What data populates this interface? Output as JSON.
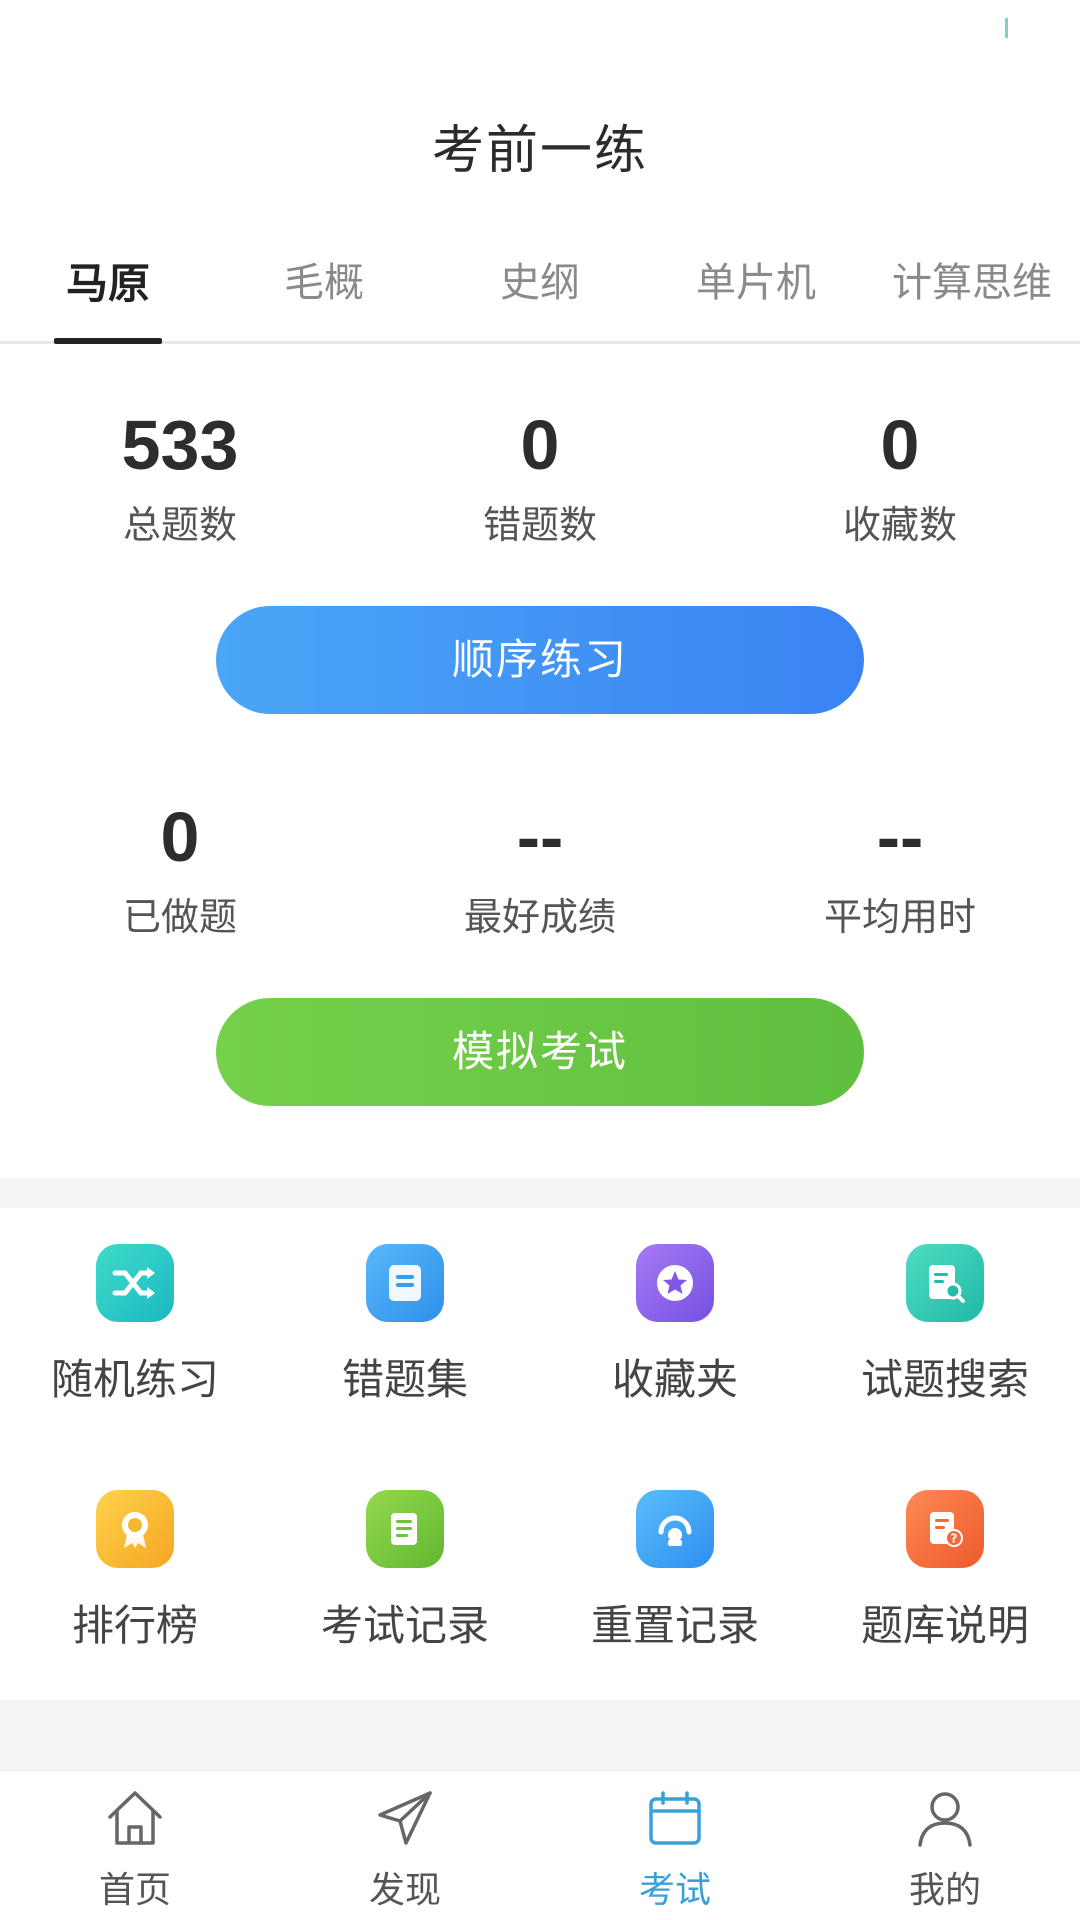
{
  "header": {
    "title": "考前一练"
  },
  "tabs": [
    {
      "label": "马原",
      "active": true
    },
    {
      "label": "毛概",
      "active": false
    },
    {
      "label": "史纲",
      "active": false
    },
    {
      "label": "单片机",
      "active": false
    },
    {
      "label": "计算思维",
      "active": false
    }
  ],
  "stats_top": [
    {
      "value": "533",
      "label": "总题数"
    },
    {
      "value": "0",
      "label": "错题数"
    },
    {
      "value": "0",
      "label": "收藏数"
    }
  ],
  "practice_button": {
    "label": "顺序练习"
  },
  "stats_bottom": [
    {
      "value": "0",
      "label": "已做题"
    },
    {
      "value": "--",
      "label": "最好成绩"
    },
    {
      "value": "--",
      "label": "平均用时"
    }
  ],
  "exam_button": {
    "label": "模拟考试"
  },
  "grid": [
    {
      "label": "随机练习",
      "icon": "shuffle-icon",
      "color": "#29c9c0"
    },
    {
      "label": "错题集",
      "icon": "document-icon",
      "color": "#3aa0f0"
    },
    {
      "label": "收藏夹",
      "icon": "star-icon",
      "color": "#8b64ea"
    },
    {
      "label": "试题搜索",
      "icon": "search-document-icon",
      "color": "#2cc7b0"
    },
    {
      "label": "排行榜",
      "icon": "award-icon",
      "color": "#f8b52c"
    },
    {
      "label": "考试记录",
      "icon": "scroll-icon",
      "color": "#79c53a"
    },
    {
      "label": "重置记录",
      "icon": "reset-icon",
      "color": "#3a9ef2"
    },
    {
      "label": "题库说明",
      "icon": "help-document-icon",
      "color": "#f66a3c"
    }
  ],
  "nav": [
    {
      "label": "首页",
      "icon": "home-icon",
      "active": false
    },
    {
      "label": "发现",
      "icon": "send-icon",
      "active": false
    },
    {
      "label": "考试",
      "icon": "calendar-icon",
      "active": true
    },
    {
      "label": "我的",
      "icon": "user-icon",
      "active": false
    }
  ],
  "colors": {
    "accent": "#3aa0d8",
    "blue_button": "#3a83f3",
    "green_button": "#5fbf3e"
  }
}
